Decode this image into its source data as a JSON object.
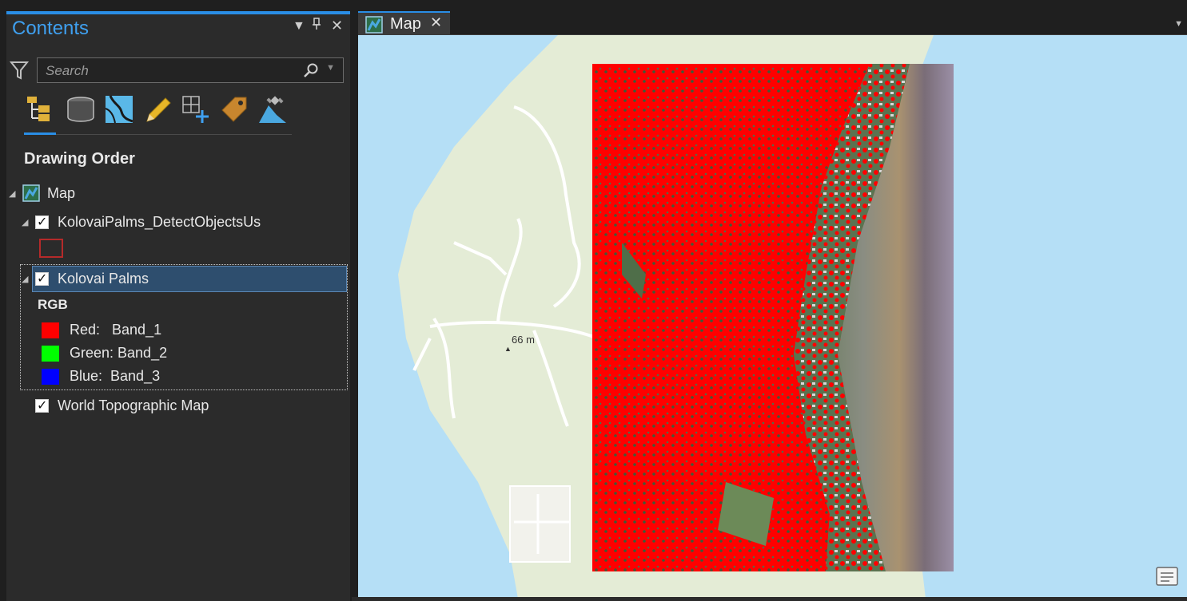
{
  "contents_pane": {
    "title": "Contents",
    "controls": {
      "menu": "▼",
      "pin": "⊥",
      "close": "✕"
    },
    "search": {
      "placeholder": "Search"
    },
    "toolbar_icons": [
      "list-by-drawing-order-icon",
      "list-by-data-source-icon",
      "list-by-selection-icon",
      "list-by-editing-icon",
      "list-by-snapping-icon",
      "list-by-labeling-icon",
      "list-by-perspective-imagery-icon"
    ],
    "section_title": "Drawing Order",
    "tree": {
      "map": {
        "label": "Map"
      },
      "detect_layer": {
        "label": "KolovaiPalms_DetectObjectsUs",
        "checked": true,
        "symbol_color": "#b52a2a"
      },
      "kolovai_layer": {
        "label": "Kolovai Palms",
        "checked": true,
        "selected": true,
        "renderer": "RGB",
        "bands": [
          {
            "label": "Red:   Band_1",
            "color": "#ff0000"
          },
          {
            "label": "Green: Band_2",
            "color": "#00ff00"
          },
          {
            "label": "Blue:  Band_3",
            "color": "#0000ff"
          }
        ]
      },
      "basemap": {
        "label": "World Topographic Map",
        "checked": true
      }
    }
  },
  "map_view": {
    "tab": {
      "label": "Map",
      "close": "✕"
    },
    "elevation_label": "66 m",
    "colors": {
      "water": "#b5dff6",
      "land": "#e4ecd6",
      "road": "#ffffff",
      "detections": "#ff0000"
    }
  }
}
